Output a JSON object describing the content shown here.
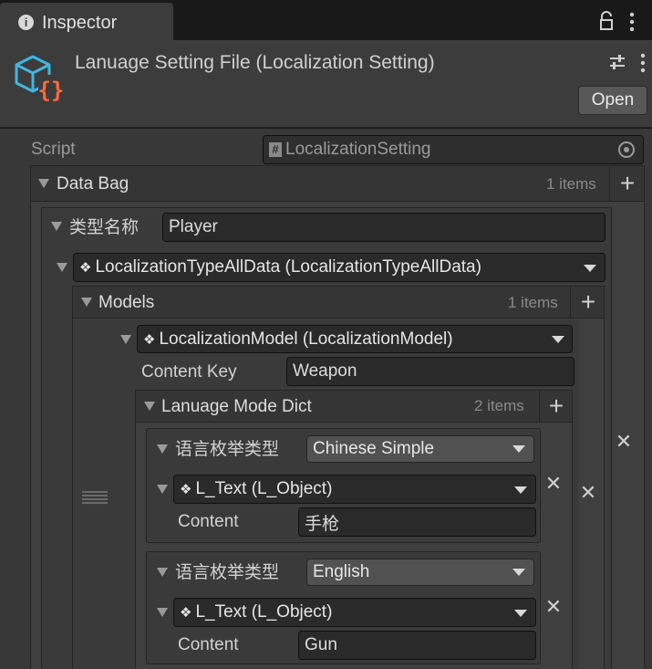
{
  "tab": {
    "title": "Inspector"
  },
  "header": {
    "object_title": "Lanuage Setting File (Localization Setting)",
    "open_label": "Open"
  },
  "script_row": {
    "label": "Script",
    "value": "LocalizationSetting"
  },
  "data_bag": {
    "label": "Data Bag",
    "count": "1 items",
    "element": {
      "type_name_label": "类型名称",
      "type_name_value": "Player",
      "type_all_data": "LocalizationTypeAllData (LocalizationTypeAllData)",
      "models": {
        "label": "Models",
        "count": "1 items",
        "model": {
          "title": "LocalizationModel (LocalizationModel)",
          "content_key_label": "Content Key",
          "content_key_value": "Weapon",
          "mode_dict": {
            "label": "Lanuage Mode Dict",
            "count": "2 items",
            "entries": [
              {
                "enum_label": "语言枚举类型",
                "enum_value": "Chinese Simple",
                "text_obj": "L_Text (L_Object)",
                "content_label": "Content",
                "content_value": "手枪"
              },
              {
                "enum_label": "语言枚举类型",
                "enum_value": "English",
                "text_obj": "L_Text (L_Object)",
                "content_label": "Content",
                "content_value": "Gun"
              }
            ]
          }
        }
      }
    }
  },
  "icons": {
    "info": "info-icon",
    "lock": "lock-icon",
    "kebab": "kebab-menu-icon",
    "asset": "json-asset-icon",
    "settings": "preset-sliders-icon",
    "target": "object-picker-icon",
    "drag": "drag-handle-icon",
    "plus": "add-icon",
    "remove": "remove-icon",
    "puzzle": "serialized-class-icon"
  },
  "colors": {
    "accent_orange": "#ff6a3d",
    "icon_blue": "#3fb6e0"
  }
}
